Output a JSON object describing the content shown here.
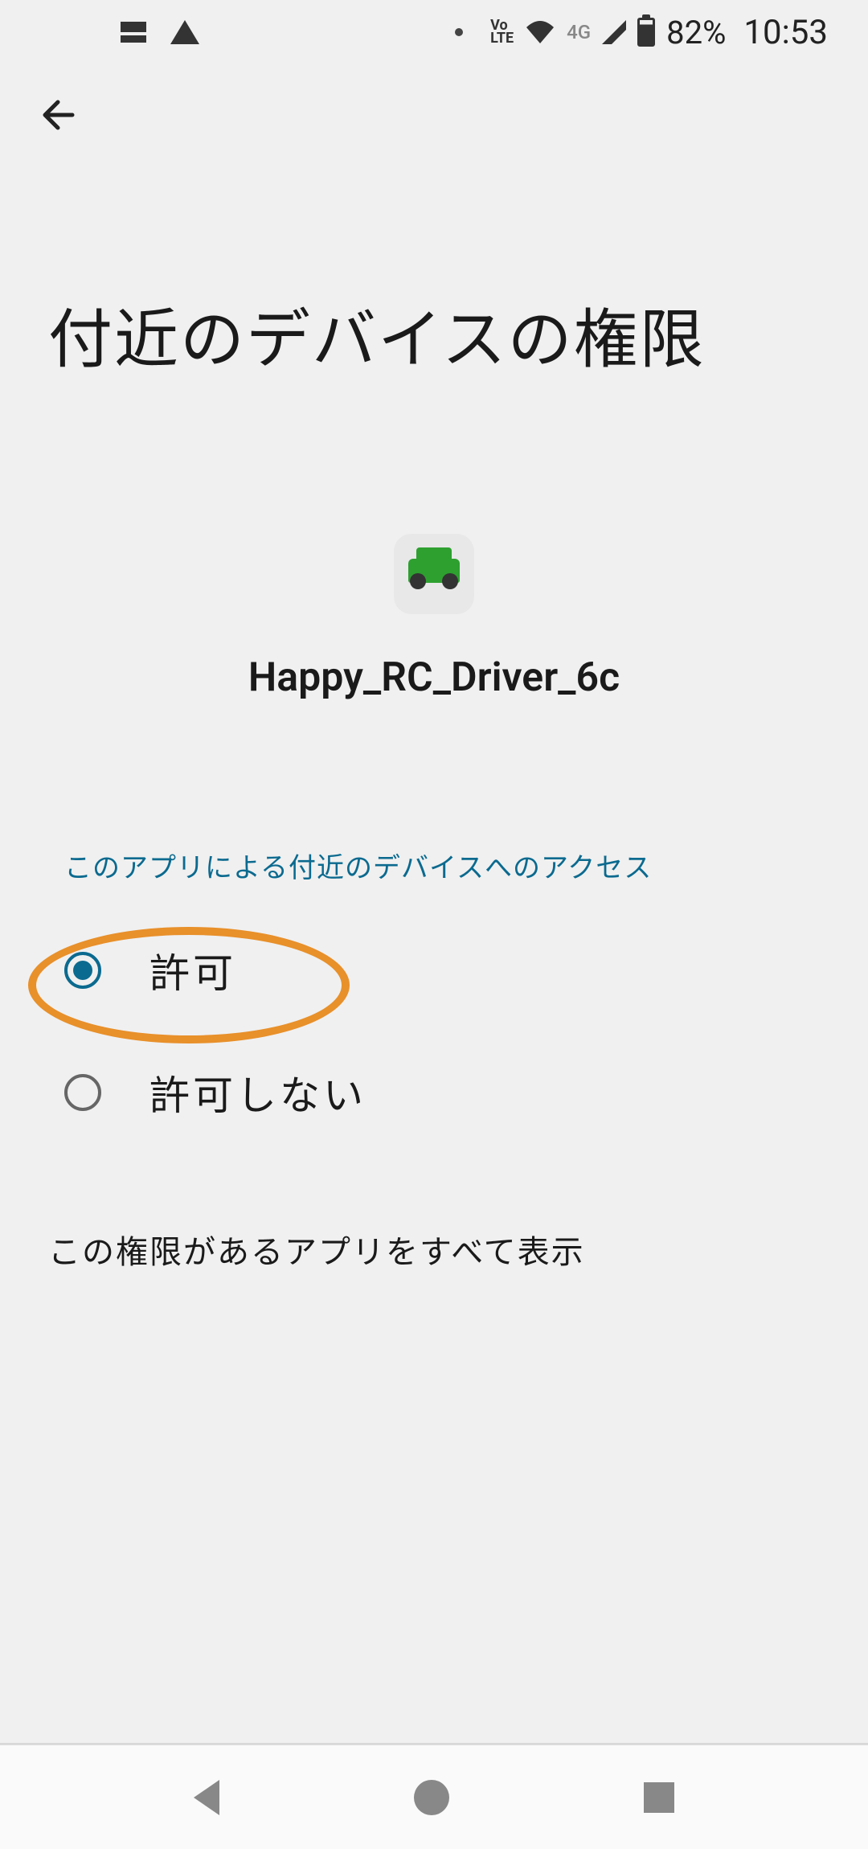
{
  "status_bar": {
    "volte": "Vo\nLTE",
    "network_type": "4G",
    "battery_percent": "82%",
    "time": "10:53"
  },
  "page": {
    "title": "付近のデバイスの権限"
  },
  "app": {
    "name": "Happy_RC_Driver_6c"
  },
  "section_label": "このアプリによる付近のデバイスへのアクセス",
  "options": {
    "allow": "許可",
    "deny": "許可しない",
    "selected_index": 0
  },
  "show_all_label": "この権限があるアプリをすべて表示"
}
